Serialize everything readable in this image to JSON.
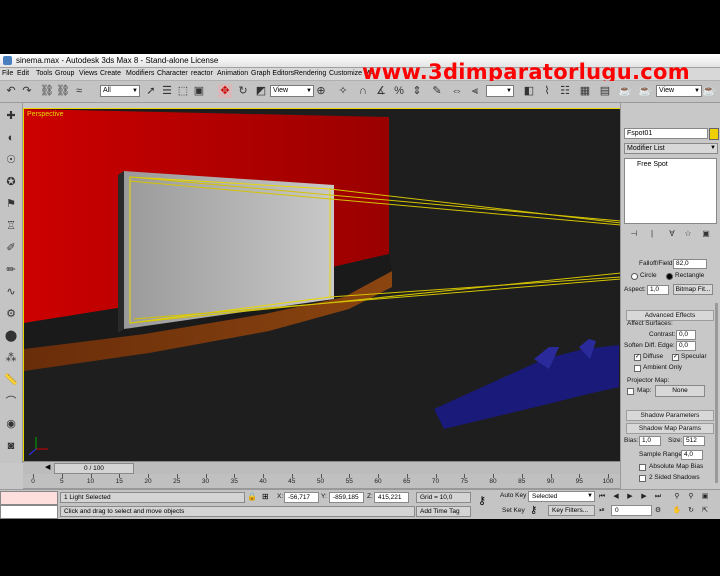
{
  "window": {
    "title": "sinema.max - Autodesk 3ds Max 8  - Stand-alone License",
    "watermark": "www.3dimparatorlugu.com"
  },
  "menu": [
    "File",
    "Edit",
    "Tools",
    "Group",
    "Views",
    "Create",
    "Modifiers",
    "Character",
    "reactor",
    "Animation",
    "Graph Editors",
    "Rendering",
    "Customize",
    "MA"
  ],
  "toolbar": {
    "selection_filter": "All",
    "ref_coord": "View",
    "right_combo": "View"
  },
  "viewport": {
    "label": "Perspective"
  },
  "command_panel": {
    "object_name": "Fspot01",
    "object_color": "#f0d000",
    "modifier_list": "Modifier List",
    "stack_item": "Free Spot",
    "falloff_label": "Falloff/Field:",
    "falloff_value": "82,0",
    "circle_label": "Circle",
    "rectangle_label": "Rectangle",
    "aspect_label": "Aspect:",
    "aspect_value": "1,0",
    "bitmap_fit": "Bitmap Fit...",
    "advanced_effects": "Advanced Effects",
    "affect_surfaces": "Affect Surfaces:",
    "contrast_label": "Contrast:",
    "contrast_value": "0,0",
    "soften_label": "Soften Diff. Edge:",
    "soften_value": "0,0",
    "diffuse_label": "Diffuse",
    "specular_label": "Specular",
    "ambient_only": "Ambient Only",
    "projector_map": "Projector Map:",
    "map_label": "Map:",
    "map_value": "None",
    "shadow_parameters": "Shadow Parameters",
    "shadow_map_params": "Shadow Map Params",
    "bias_label": "Bias:",
    "bias_value": "1,0",
    "size_label": "Size:",
    "size_value": "512",
    "sample_range_label": "Sample Range:",
    "sample_range_value": "4,0",
    "absolute_map_bias": "Absolute Map Bias",
    "two_sided_shadows": "2 Sided Shadows"
  },
  "timeline": {
    "slider": "0 / 100",
    "ticks": [
      "0",
      "5",
      "10",
      "15",
      "20",
      "25",
      "30",
      "35",
      "40",
      "45",
      "50",
      "55",
      "60",
      "65",
      "70",
      "75",
      "80",
      "85",
      "90",
      "95",
      "100"
    ]
  },
  "status": {
    "selection": "1 Light Selected",
    "prompt": "Click and drag to select and move objects",
    "x_label": "X:",
    "x_value": "-56,717",
    "y_label": "Y:",
    "y_value": "-859,185",
    "z_label": "Z:",
    "z_value": "415,221",
    "grid": "Grid = 10,0",
    "add_time_tag": "Add Time Tag",
    "auto_key": "Auto Key",
    "key_mode": "Selected",
    "set_key": "Set Key",
    "key_filters": "Key Filters...",
    "frame": "0"
  }
}
